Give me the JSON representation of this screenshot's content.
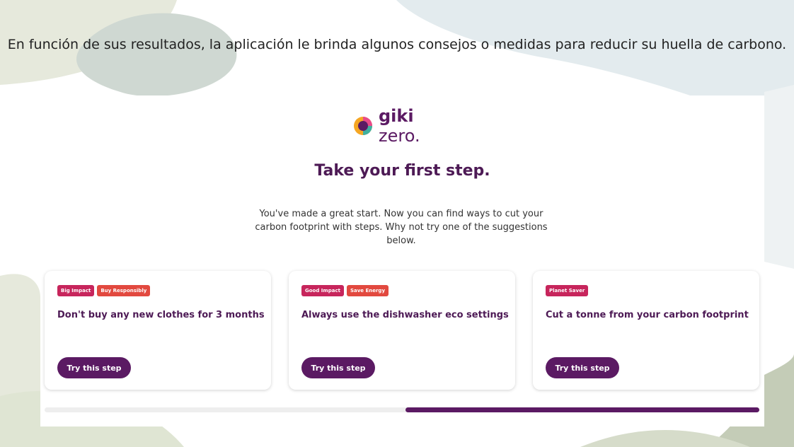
{
  "slide": {
    "caption": "En función de sus resultados, la aplicación le brinda algunos consejos o medidas para reducir su huella de carbono."
  },
  "app": {
    "logo_bold": "giki",
    "logo_rest": " zero.",
    "heading": "Take your first step.",
    "intro": "You've made a great start. Now you can find ways to cut your carbon footprint with steps. Why not try one of the suggestions below."
  },
  "cards": [
    {
      "tags": [
        "Big Impact",
        "Buy Responsibly"
      ],
      "title": "Don't buy any new clothes for 3 months",
      "button": "Try this step"
    },
    {
      "tags": [
        "Good Impact",
        "Save Energy"
      ],
      "title": "Always use the dishwasher eco settings",
      "button": "Try this step"
    },
    {
      "tags": [
        "Planet Saver"
      ],
      "title": "Cut a tonne from your carbon footprint",
      "button": "Try this step"
    }
  ],
  "scrollbar": {
    "position_fraction": 0.5
  },
  "colors": {
    "brand_purple": "#5b1a63",
    "impact_pink": "#c7255c",
    "category_red": "#e2493f"
  }
}
